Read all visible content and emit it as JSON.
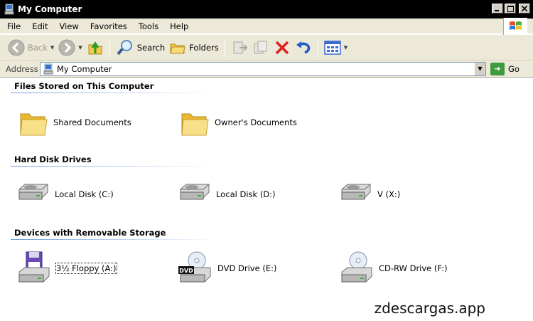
{
  "window": {
    "title": "My Computer"
  },
  "menu": {
    "items": [
      "File",
      "Edit",
      "View",
      "Favorites",
      "Tools",
      "Help"
    ]
  },
  "toolbar": {
    "back_label": "Back",
    "search_label": "Search",
    "folders_label": "Folders"
  },
  "address": {
    "label": "Address",
    "value": "My Computer",
    "go_label": "Go"
  },
  "groups": {
    "files": {
      "title": "Files Stored on This Computer",
      "items": [
        "Shared Documents",
        "Owner's Documents"
      ]
    },
    "drives": {
      "title": "Hard Disk Drives",
      "items": [
        "Local Disk (C:)",
        "Local Disk (D:)",
        "V (X:)"
      ]
    },
    "removable": {
      "title": "Devices with Removable Storage",
      "items": [
        "3½ Floppy (A:)",
        "DVD Drive (E:)",
        "CD-RW Drive (F:)"
      ],
      "dvd_badge": "DVD"
    }
  },
  "watermark": "zdescargas.app"
}
